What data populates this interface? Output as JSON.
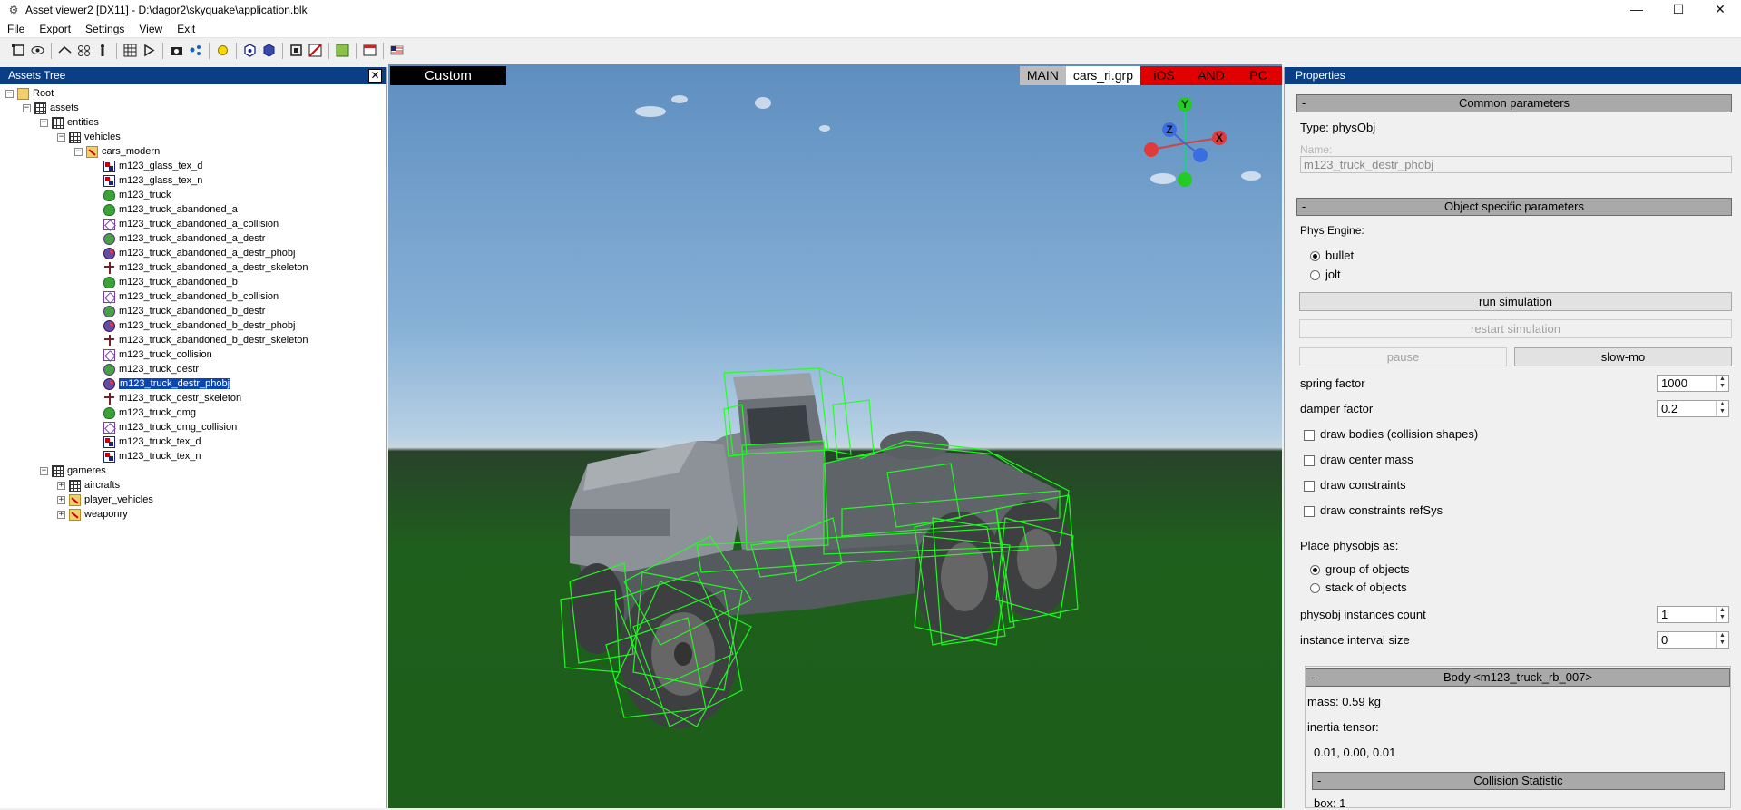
{
  "window": {
    "title": "Asset viewer2  [DX11]  - D:\\dagor2\\skyquake\\application.blk",
    "controls": [
      "—",
      "☐",
      "✕"
    ]
  },
  "menu": [
    "File",
    "Export",
    "Settings",
    "View",
    "Exit"
  ],
  "toolbar_icons": [
    "select-icon",
    "eye-icon",
    "split-icon",
    "group-icon",
    "figure-icon",
    "grid-icon",
    "play-icon",
    "camera-icon",
    "nodes-icon",
    "light-icon",
    "cube-icon",
    "cube-solid-icon",
    "frame-icon",
    "no-collision-icon",
    "material-icon",
    "window-icon",
    "flag-icon"
  ],
  "assets_tree": {
    "title": "Assets Tree",
    "close": "✕",
    "nodes": [
      {
        "label": "Root",
        "icon": "folder",
        "toggle": "−",
        "level": 0
      },
      {
        "label": "assets",
        "icon": "pkg",
        "toggle": "−",
        "level": 1
      },
      {
        "label": "entities",
        "icon": "pkg",
        "toggle": "−",
        "level": 2
      },
      {
        "label": "vehicles",
        "icon": "pkg",
        "toggle": "−",
        "level": 3
      },
      {
        "label": "cars_modern",
        "icon": "grp",
        "toggle": "−",
        "level": 4
      },
      {
        "label": "m123_glass_tex_d",
        "icon": "tex",
        "level": 5
      },
      {
        "label": "m123_glass_tex_n",
        "icon": "tex",
        "level": 5
      },
      {
        "label": "m123_truck",
        "icon": "dyn",
        "level": 5
      },
      {
        "label": "m123_truck_abandoned_a",
        "icon": "dyn",
        "level": 5
      },
      {
        "label": "m123_truck_abandoned_a_collision",
        "icon": "col",
        "level": 5
      },
      {
        "label": "m123_truck_abandoned_a_destr",
        "icon": "destr",
        "level": 5
      },
      {
        "label": "m123_truck_abandoned_a_destr_phobj",
        "icon": "phobj",
        "level": 5
      },
      {
        "label": "m123_truck_abandoned_a_destr_skeleton",
        "icon": "skel",
        "level": 5
      },
      {
        "label": "m123_truck_abandoned_b",
        "icon": "dyn",
        "level": 5
      },
      {
        "label": "m123_truck_abandoned_b_collision",
        "icon": "col",
        "level": 5
      },
      {
        "label": "m123_truck_abandoned_b_destr",
        "icon": "destr",
        "level": 5
      },
      {
        "label": "m123_truck_abandoned_b_destr_phobj",
        "icon": "phobj",
        "level": 5
      },
      {
        "label": "m123_truck_abandoned_b_destr_skeleton",
        "icon": "skel",
        "level": 5
      },
      {
        "label": "m123_truck_collision",
        "icon": "col",
        "level": 5
      },
      {
        "label": "m123_truck_destr",
        "icon": "destr",
        "level": 5
      },
      {
        "label": "m123_truck_destr_phobj",
        "icon": "phobj",
        "level": 5,
        "selected": true
      },
      {
        "label": "m123_truck_destr_skeleton",
        "icon": "skel",
        "level": 5
      },
      {
        "label": "m123_truck_dmg",
        "icon": "dyn",
        "level": 5
      },
      {
        "label": "m123_truck_dmg_collision",
        "icon": "col",
        "level": 5
      },
      {
        "label": "m123_truck_tex_d",
        "icon": "tex",
        "level": 5
      },
      {
        "label": "m123_truck_tex_n",
        "icon": "tex",
        "level": 5
      },
      {
        "label": "gameres",
        "icon": "pkg",
        "toggle": "−",
        "level": 2
      },
      {
        "label": "aircrafts",
        "icon": "pkg",
        "toggle": "+",
        "level": 3
      },
      {
        "label": "player_vehicles",
        "icon": "grp",
        "toggle": "+",
        "level": 3
      },
      {
        "label": "weaponry",
        "icon": "grp",
        "toggle": "+",
        "level": 3
      }
    ]
  },
  "viewport": {
    "mode": "Custom",
    "tabs": [
      "MAIN",
      "cars_ri.grp",
      "iOS",
      "AND",
      "PC"
    ],
    "gizmo": {
      "y": "Y",
      "z": "Z",
      "x": "X"
    }
  },
  "properties": {
    "title": "Properties",
    "common": {
      "header": "Common parameters",
      "collapse": "-",
      "type_label": "Type: physObj",
      "name_label": "Name:",
      "name_value": "m123_truck_destr_phobj"
    },
    "object": {
      "header": "Object specific parameters",
      "collapse": "-",
      "phys_engine_label": "Phys Engine:",
      "engines": [
        "bullet",
        "jolt"
      ],
      "run": "run simulation",
      "restart": "restart simulation",
      "pause": "pause",
      "slowmo": "slow-mo",
      "spring_label": "spring factor",
      "spring_value": "1000",
      "damper_label": "damper factor",
      "damper_value": "0.2",
      "checks": [
        "draw bodies (collision shapes)",
        "draw center mass",
        "draw constraints",
        "draw constraints refSys"
      ],
      "place_label": "Place physobjs as:",
      "place_options": [
        "group of objects",
        "stack of objects"
      ],
      "count_label": "physobj instances count",
      "count_value": "1",
      "interval_label": "instance interval size",
      "interval_value": "0"
    },
    "body": {
      "header": "Body <m123_truck_rb_007>",
      "collapse": "-",
      "mass": "mass: 0.59 kg",
      "inertia_label": "inertia tensor:",
      "inertia_value": "0.01, 0.00, 0.01",
      "collision_header": "Collision Statistic",
      "box": "box: 1"
    }
  },
  "colors": {
    "panel_header": "#0a3f86",
    "selection": "#0a46b4",
    "platform_tab": "#e00000",
    "wireframe": "#22ff22"
  }
}
